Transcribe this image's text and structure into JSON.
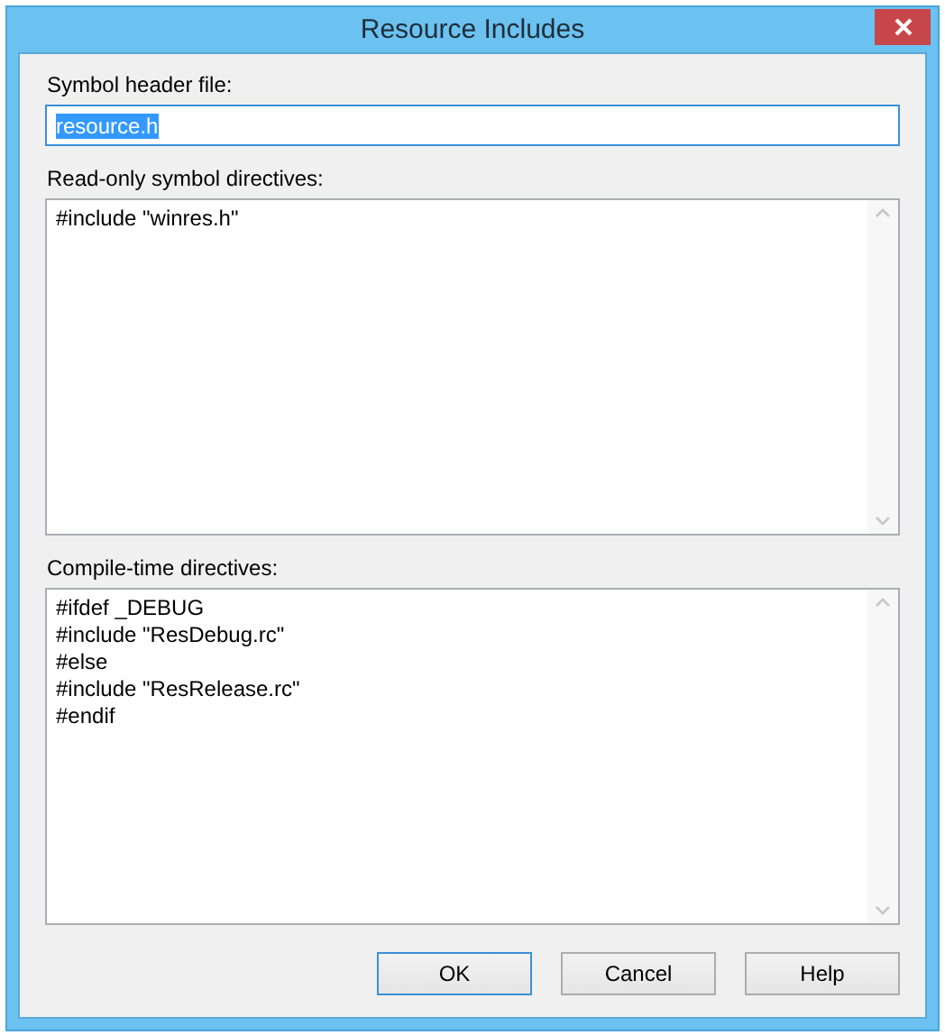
{
  "window": {
    "title": "Resource Includes"
  },
  "symbol_header": {
    "label": "Symbol header file:",
    "value": "resource.h",
    "value_selected": true
  },
  "read_only_directives": {
    "label": "Read-only symbol directives:",
    "lines": [
      "#include \"winres.h\""
    ]
  },
  "compile_time_directives": {
    "label": "Compile-time directives:",
    "lines": [
      "#ifdef _DEBUG",
      "#include \"ResDebug.rc\"",
      "#else",
      "#include \"ResRelease.rc\"",
      "#endif"
    ]
  },
  "buttons": [
    {
      "label": "OK",
      "default": true
    },
    {
      "label": "Cancel",
      "default": false
    },
    {
      "label": "Help",
      "default": false
    }
  ]
}
